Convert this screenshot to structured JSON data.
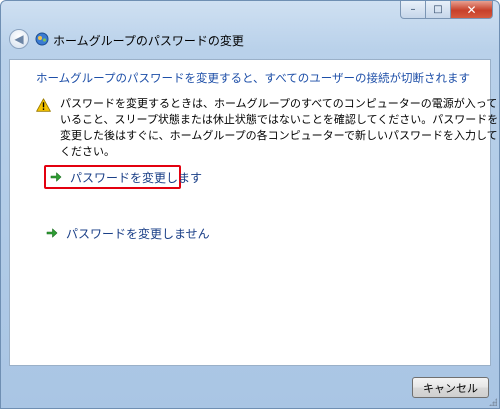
{
  "window": {
    "title": "ホームグループのパスワードの変更",
    "caption": {
      "minimize_glyph": "–",
      "maximize_glyph": "□",
      "close_glyph": "✕"
    },
    "back_glyph": "◀"
  },
  "content": {
    "heading": "ホームグループのパスワードを変更すると、すべてのユーザーの接続が切断されます",
    "warning_lines": [
      "パスワードを変更するときは、ホームグループのすべてのコンピューターの電源が入って",
      "いること、スリープ状態または休止状態ではないことを確認してください。パスワードを",
      "変更した後はすぐに、ホームグループの各コンピューターで新しいパスワードを入力して",
      "ください。"
    ],
    "options": {
      "change": "パスワードを変更します",
      "no_change": "パスワードを変更しません"
    }
  },
  "footer": {
    "cancel_label": "キャンセル"
  },
  "colors": {
    "heading": "#1e4fa8",
    "link": "#1a3f87",
    "highlight_border": "#e3000f",
    "arrow_green": "#2e9e33",
    "warning_yellow": "#f5c400"
  },
  "icons": {
    "back": "back-arrow-icon",
    "homegroup": "homegroup-icon",
    "warning": "warning-icon",
    "option_arrow": "green-arrow-icon"
  }
}
